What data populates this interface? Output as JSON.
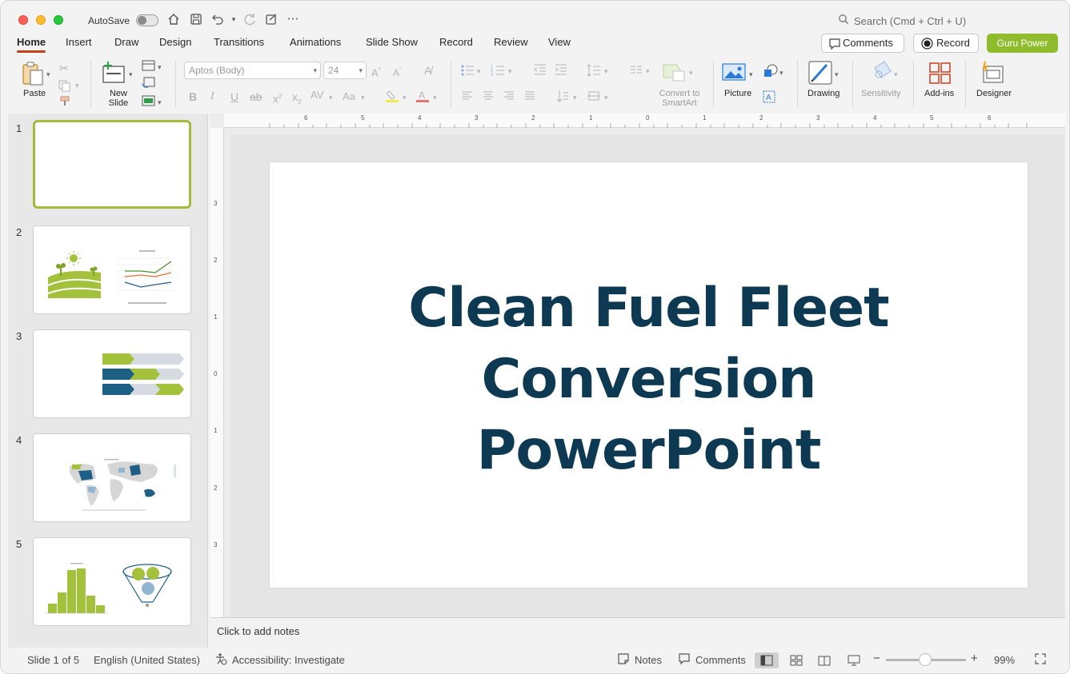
{
  "titlebar": {
    "autosave_label": "AutoSave",
    "search_placeholder": "Search (Cmd + Ctrl + U)"
  },
  "tabs": [
    {
      "label": "Home",
      "active": true
    },
    {
      "label": "Insert"
    },
    {
      "label": "Draw"
    },
    {
      "label": "Design"
    },
    {
      "label": "Transitions"
    },
    {
      "label": "Animations"
    },
    {
      "label": "Slide Show"
    },
    {
      "label": "Record"
    },
    {
      "label": "Review"
    },
    {
      "label": "View"
    }
  ],
  "header_buttons": {
    "comments": "Comments",
    "record": "Record",
    "guru": "Guru Power"
  },
  "ribbon": {
    "paste": "Paste",
    "new_slide": "New Slide",
    "font_name": "Aptos (Body)",
    "font_size": "24",
    "convert_smartart": "Convert to SmartArt",
    "picture": "Picture",
    "drawing": "Drawing",
    "sensitivity": "Sensitivity",
    "addins": "Add-ins",
    "designer": "Designer"
  },
  "slides": [
    {
      "number": "1",
      "selected": true
    },
    {
      "number": "2"
    },
    {
      "number": "3"
    },
    {
      "number": "4"
    },
    {
      "number": "5"
    }
  ],
  "slide": {
    "title_line1": "Clean Fuel Fleet",
    "title_line2": "Conversion",
    "title_line3": "PowerPoint"
  },
  "notes": {
    "placeholder": "Click to add notes"
  },
  "statusbar": {
    "slide_position": "Slide 1 of 5",
    "language": "English (United States)",
    "accessibility": "Accessibility: Investigate",
    "notes_button": "Notes",
    "comments_button": "Comments",
    "zoom_level": "99%"
  },
  "colors": {
    "accent_green": "#8fbc2c",
    "title_navy": "#0d3a52",
    "tab_underline": "#c43e1c",
    "thumb_green": "#a3c13a",
    "thumb_blue": "#1d5f85"
  }
}
